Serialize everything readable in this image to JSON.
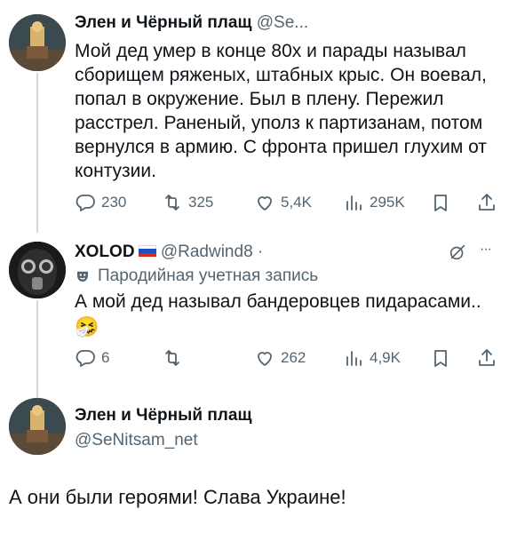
{
  "tweet1": {
    "author_name": "Элен и Чёрный плащ",
    "author_handle": "@Se...",
    "text": "Мой дед умер в конце 80х и парады называл сборищем ряженых, штабных крыс. Он воевал, попал в окружение. Был в плену. Пережил расстрел. Раненый, уполз к партизанам, потом вернулся в армию. С фронта пришел глухим от контузии.",
    "replies": "230",
    "retweets": "325",
    "likes": "5,4K",
    "views": "295K"
  },
  "tweet2": {
    "author_name": "XOLOD",
    "author_handle": "@Radwind8 ·",
    "parody_label": "Пародийная учетная запись",
    "text": "А мой дед называл бандеровцев пидарасами..",
    "emoji": "🤧",
    "replies": "6",
    "retweets": "",
    "likes": "262",
    "views": "4,9K",
    "more": "···"
  },
  "tweet3": {
    "author_name": "Элен и Чёрный плащ",
    "author_handle": "@SeNitsam_net",
    "text": "А они были героями! Слава Украине!"
  },
  "colors": {
    "text": "#0f1419",
    "secondary": "#536471",
    "thread_line": "#cfd9de"
  },
  "icons": [
    "reply-icon",
    "retweet-icon",
    "like-icon",
    "views-icon",
    "bookmark-icon",
    "share-icon",
    "grok-icon",
    "more-icon",
    "parody-mask-icon",
    "russia-flag-icon"
  ]
}
